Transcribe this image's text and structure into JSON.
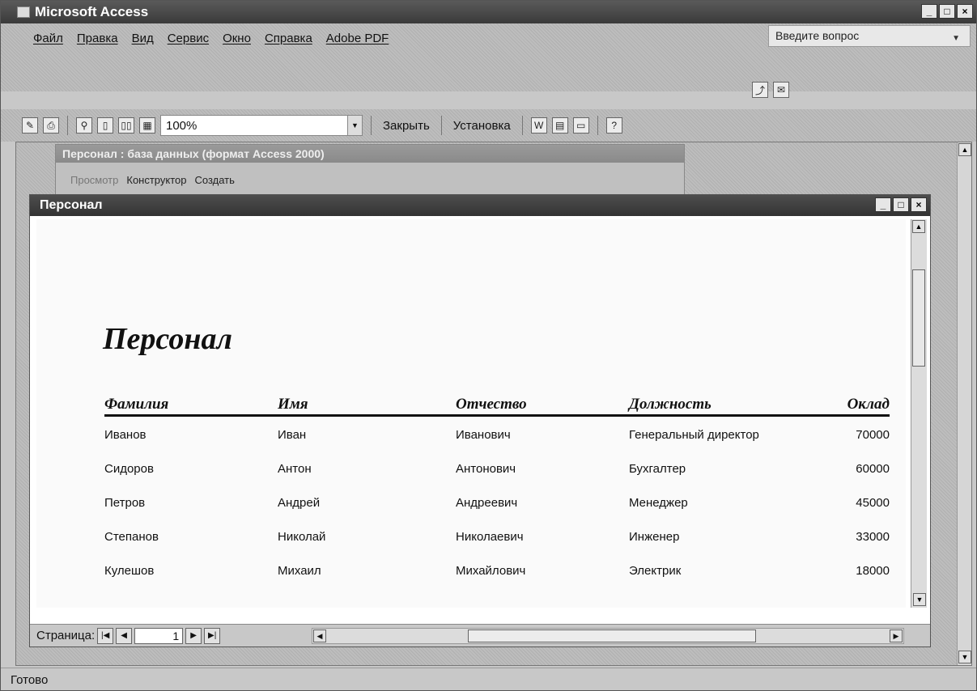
{
  "app": {
    "title": "Microsoft Access"
  },
  "menu": {
    "items": [
      "Файл",
      "Правка",
      "Вид",
      "Сервис",
      "Окно",
      "Справка",
      "Adobe PDF"
    ],
    "help_placeholder": "Введите вопрос"
  },
  "toolbar": {
    "zoom": "100%",
    "close_label": "Закрыть",
    "setup_label": "Установка"
  },
  "db_window": {
    "title": "Персонал : база данных (формат Access 2000)",
    "view_label": "Просмотр",
    "design_label": "Конструктор",
    "create_label": "Создать"
  },
  "report_window": {
    "title": "Персонал"
  },
  "report": {
    "title": "Персонал",
    "columns": [
      "Фамилия",
      "Имя",
      "Отчество",
      "Должность",
      "Оклад"
    ],
    "rows": [
      [
        "Иванов",
        "Иван",
        "Иванович",
        "Генеральный директор",
        "70000"
      ],
      [
        "Сидоров",
        "Антон",
        "Антонович",
        "Бухгалтер",
        "60000"
      ],
      [
        "Петров",
        "Андрей",
        "Андреевич",
        "Менеджер",
        "45000"
      ],
      [
        "Степанов",
        "Николай",
        "Николаевич",
        "Инженер",
        "33000"
      ],
      [
        "Кулешов",
        "Михаил",
        "Михайлович",
        "Электрик",
        "18000"
      ]
    ]
  },
  "navigation": {
    "page_label": "Страница:",
    "page_number": "1"
  },
  "status": {
    "text": "Готово"
  }
}
